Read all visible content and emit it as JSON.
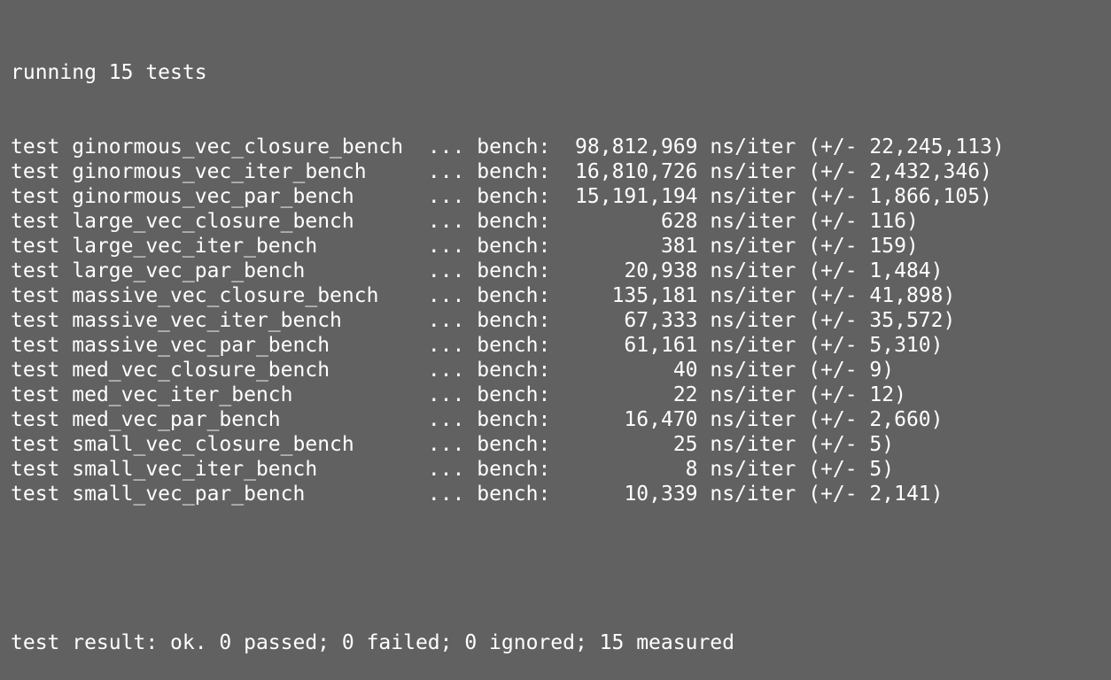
{
  "header": "running 15 tests",
  "rows": [
    {
      "prefix": "test",
      "name": "ginormous_vec_closure_bench",
      "sep": "...",
      "label": "bench:",
      "value": "98,812,969",
      "unit": "ns/iter",
      "dev": "(+/- 22,245,113)"
    },
    {
      "prefix": "test",
      "name": "ginormous_vec_iter_bench",
      "sep": "...",
      "label": "bench:",
      "value": "16,810,726",
      "unit": "ns/iter",
      "dev": "(+/- 2,432,346)"
    },
    {
      "prefix": "test",
      "name": "ginormous_vec_par_bench",
      "sep": "...",
      "label": "bench:",
      "value": "15,191,194",
      "unit": "ns/iter",
      "dev": "(+/- 1,866,105)"
    },
    {
      "prefix": "test",
      "name": "large_vec_closure_bench",
      "sep": "...",
      "label": "bench:",
      "value": "628",
      "unit": "ns/iter",
      "dev": "(+/- 116)"
    },
    {
      "prefix": "test",
      "name": "large_vec_iter_bench",
      "sep": "...",
      "label": "bench:",
      "value": "381",
      "unit": "ns/iter",
      "dev": "(+/- 159)"
    },
    {
      "prefix": "test",
      "name": "large_vec_par_bench",
      "sep": "...",
      "label": "bench:",
      "value": "20,938",
      "unit": "ns/iter",
      "dev": "(+/- 1,484)"
    },
    {
      "prefix": "test",
      "name": "massive_vec_closure_bench",
      "sep": "...",
      "label": "bench:",
      "value": "135,181",
      "unit": "ns/iter",
      "dev": "(+/- 41,898)"
    },
    {
      "prefix": "test",
      "name": "massive_vec_iter_bench",
      "sep": "...",
      "label": "bench:",
      "value": "67,333",
      "unit": "ns/iter",
      "dev": "(+/- 35,572)"
    },
    {
      "prefix": "test",
      "name": "massive_vec_par_bench",
      "sep": "...",
      "label": "bench:",
      "value": "61,161",
      "unit": "ns/iter",
      "dev": "(+/- 5,310)"
    },
    {
      "prefix": "test",
      "name": "med_vec_closure_bench",
      "sep": "...",
      "label": "bench:",
      "value": "40",
      "unit": "ns/iter",
      "dev": "(+/- 9)"
    },
    {
      "prefix": "test",
      "name": "med_vec_iter_bench",
      "sep": "...",
      "label": "bench:",
      "value": "22",
      "unit": "ns/iter",
      "dev": "(+/- 12)"
    },
    {
      "prefix": "test",
      "name": "med_vec_par_bench",
      "sep": "...",
      "label": "bench:",
      "value": "16,470",
      "unit": "ns/iter",
      "dev": "(+/- 2,660)"
    },
    {
      "prefix": "test",
      "name": "small_vec_closure_bench",
      "sep": "...",
      "label": "bench:",
      "value": "25",
      "unit": "ns/iter",
      "dev": "(+/- 5)"
    },
    {
      "prefix": "test",
      "name": "small_vec_iter_bench",
      "sep": "...",
      "label": "bench:",
      "value": "8",
      "unit": "ns/iter",
      "dev": "(+/- 5)"
    },
    {
      "prefix": "test",
      "name": "small_vec_par_bench",
      "sep": "...",
      "label": "bench:",
      "value": "10,339",
      "unit": "ns/iter",
      "dev": "(+/- 2,141)"
    }
  ],
  "result": "test result: ok. 0 passed; 0 failed; 0 ignored; 15 measured",
  "colors": {
    "background": "#616161",
    "text": "#ffffff"
  }
}
